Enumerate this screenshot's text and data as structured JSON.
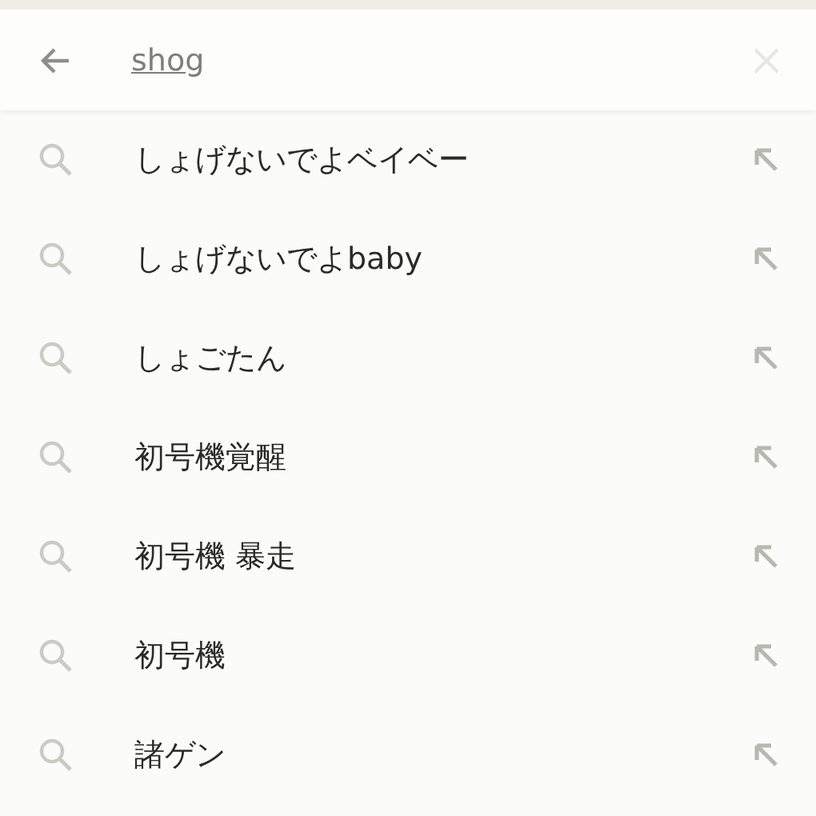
{
  "search": {
    "value": "shog"
  },
  "suggestions": [
    {
      "text": "しょげないでよベイベー"
    },
    {
      "text": "しょげないでよbaby"
    },
    {
      "text": "しょごたん"
    },
    {
      "text": "初号機覚醒"
    },
    {
      "text": "初号機 暴走"
    },
    {
      "text": "初号機"
    },
    {
      "text": "諸ゲン"
    }
  ]
}
